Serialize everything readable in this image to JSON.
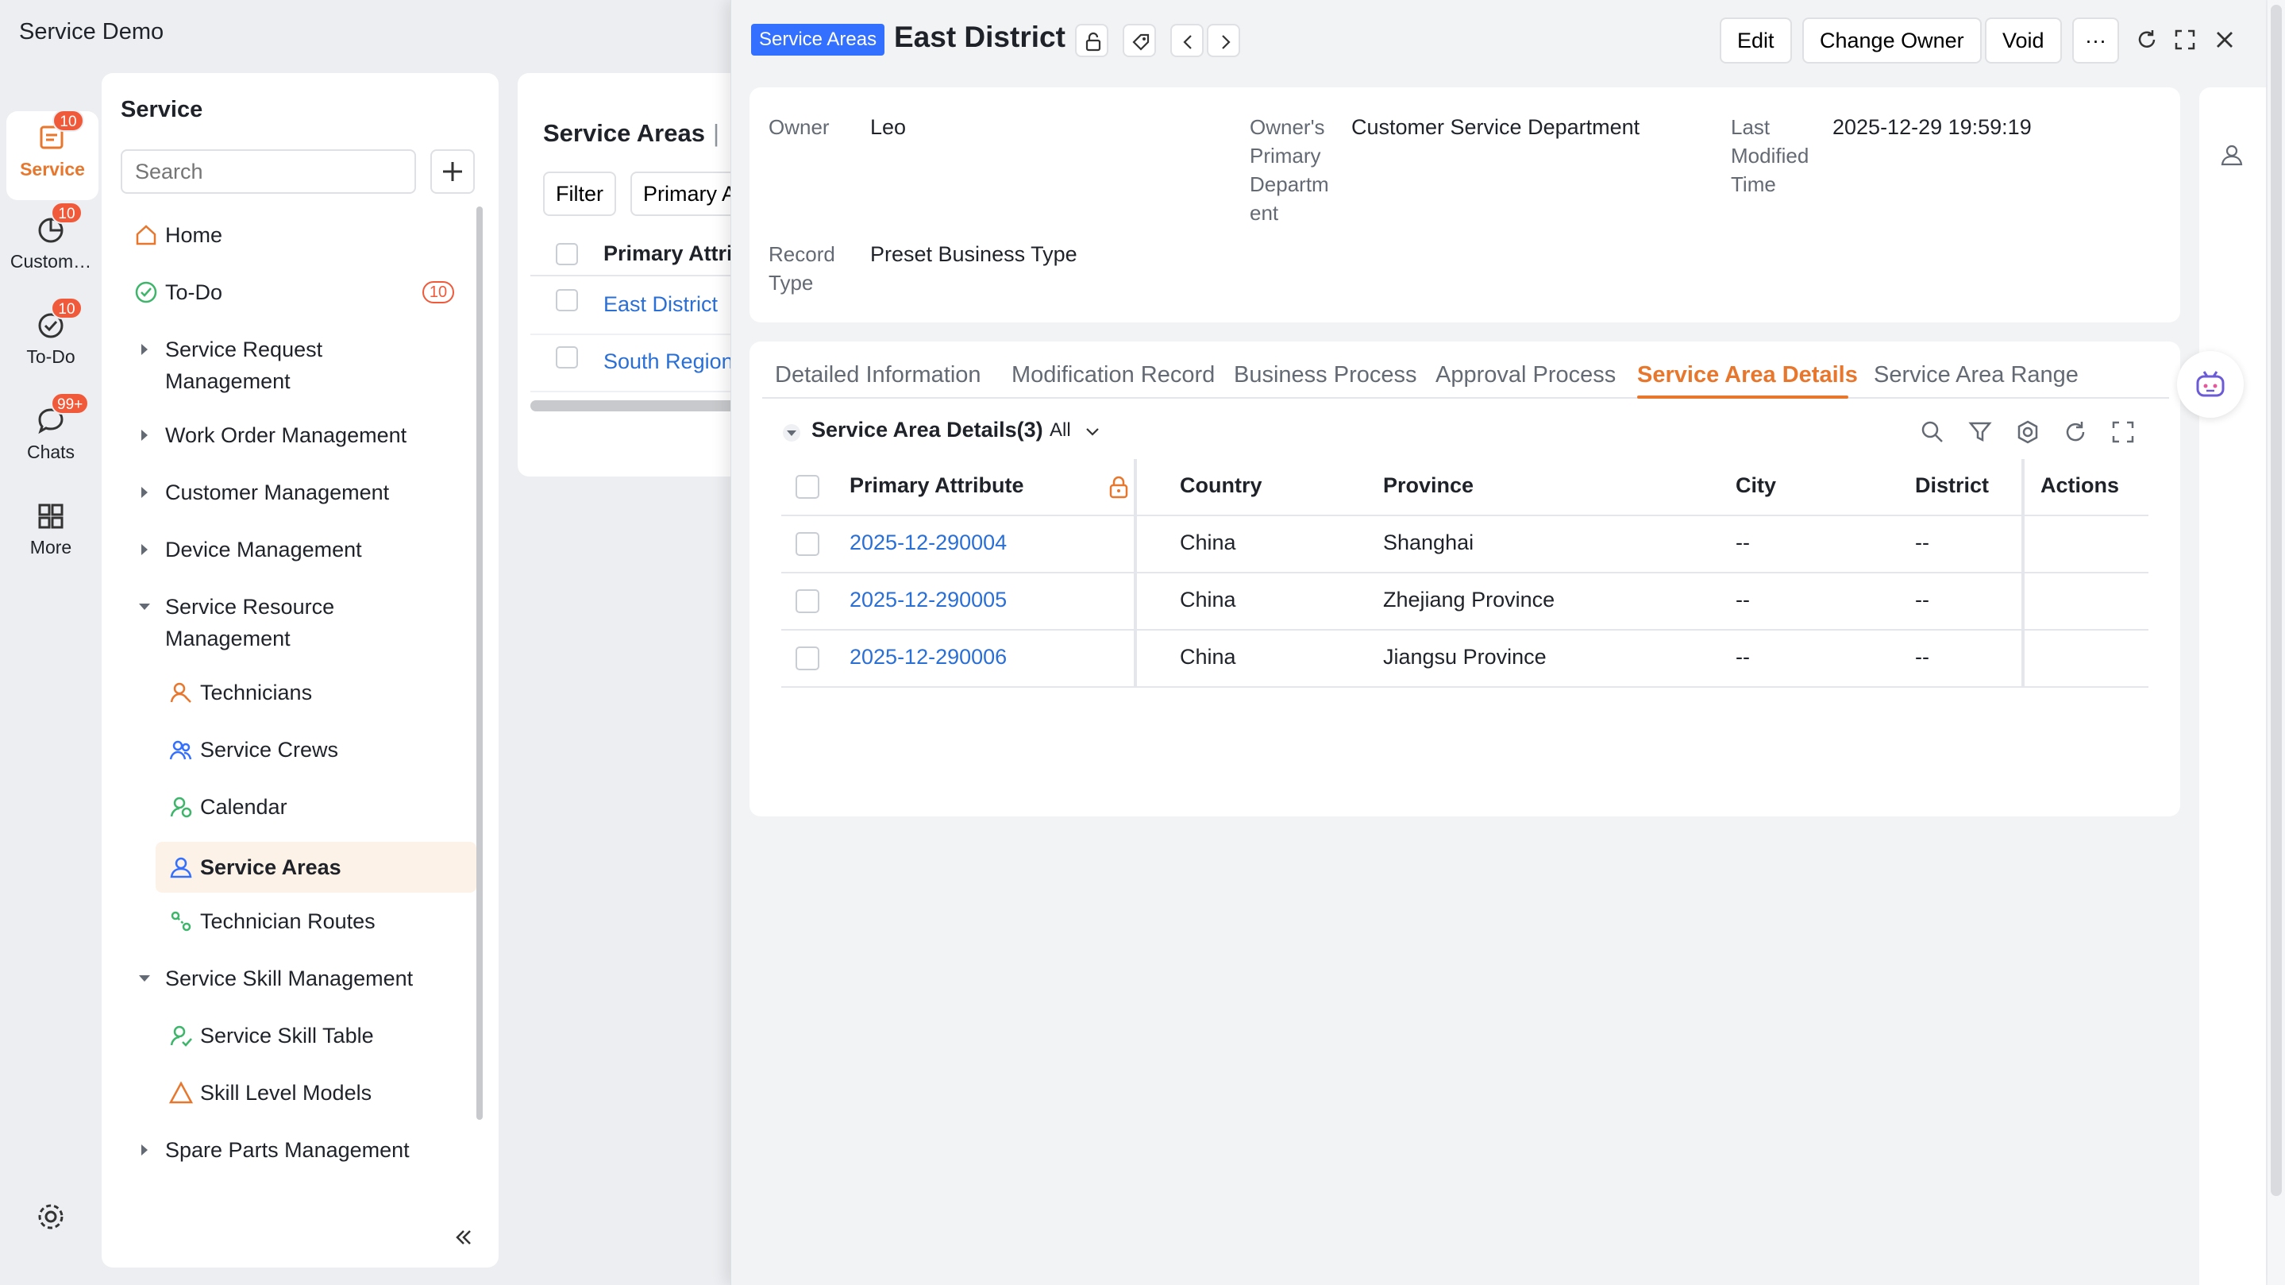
{
  "app": {
    "title": "Service Demo"
  },
  "rail": {
    "items": [
      {
        "label": "Service",
        "badge": "10"
      },
      {
        "label": "Custom…",
        "badge": "10"
      },
      {
        "label": "To-Do",
        "badge": "10"
      },
      {
        "label": "Chats",
        "badge": "99+"
      },
      {
        "label": "More"
      }
    ]
  },
  "nav": {
    "title": "Service",
    "search_placeholder": "Search",
    "items": {
      "home": "Home",
      "todo": "To-Do",
      "todo_badge": "10",
      "service_request_1": "Service Request",
      "service_request_2": "Management",
      "work_order": "Work Order Management",
      "customer": "Customer Management",
      "device": "Device Management",
      "service_resource_1": "Service Resource",
      "service_resource_2": "Management",
      "technicians": "Technicians",
      "service_crews": "Service Crews",
      "calendar": "Calendar",
      "service_areas": "Service Areas",
      "technician_routes": "Technician Routes",
      "service_skill": "Service Skill Management",
      "service_skill_table": "Service Skill Table",
      "skill_level_models": "Skill Level Models",
      "spare_parts": "Spare Parts Management"
    }
  },
  "list": {
    "heading": "Service Areas",
    "heading_suffix": "|",
    "filter_label": "Filter",
    "view_label": "Primary A",
    "column_header": "Primary Attrib",
    "rows": [
      "East District",
      "South  Region"
    ]
  },
  "drawer": {
    "tag": "Service Areas",
    "title": "East District",
    "buttons": {
      "edit": "Edit",
      "change_owner": "Change Owner",
      "void": "Void",
      "more": "···"
    },
    "fields": {
      "owner_label": "Owner",
      "owner_value": "Leo",
      "dept_label_1": "Owner's",
      "dept_label_2": "Primary",
      "dept_label_3": "Departm",
      "dept_label_4": "ent",
      "dept_value": "Customer Service Department",
      "modified_label_1": "Last",
      "modified_label_2": "Modified",
      "modified_label_3": "Time",
      "modified_value": "2025-12-29 19:59:19",
      "record_label_1": "Record",
      "record_label_2": "Type",
      "record_value": "Preset Business Type"
    },
    "tabs": [
      "Detailed Information",
      "Modification Record",
      "Business Process",
      "Approval Process",
      "Service Area Details",
      "Service Area Range"
    ],
    "active_tab": "Service Area Details",
    "details": {
      "heading": "Service Area Details(3)",
      "filter": "All",
      "columns": {
        "primary": "Primary Attribute",
        "country": "Country",
        "province": "Province",
        "city": "City",
        "district": "District",
        "actions": "Actions"
      },
      "rows": [
        {
          "primary": "2025-12-290004",
          "country": "China",
          "province": "Shanghai",
          "city": "--",
          "district": "--"
        },
        {
          "primary": "2025-12-290005",
          "country": "China",
          "province": "Zhejiang Province",
          "city": "--",
          "district": "--"
        },
        {
          "primary": "2025-12-290006",
          "country": "China",
          "province": "Jiangsu Province",
          "city": "--",
          "district": "--"
        }
      ]
    }
  },
  "colors": {
    "accent": "#e8772e",
    "link": "#2a6fd6",
    "tag": "#3370ff",
    "badge": "#f05a3a"
  }
}
